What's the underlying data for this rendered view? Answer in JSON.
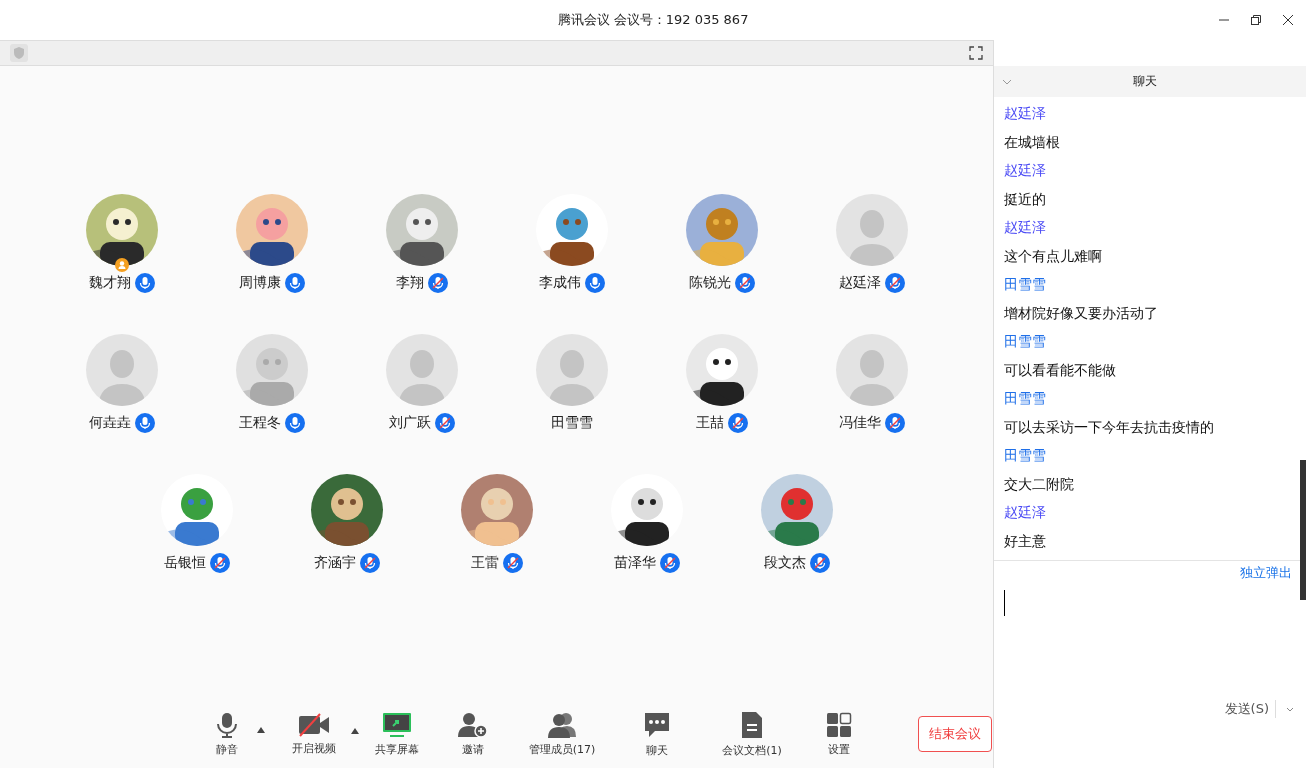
{
  "window": {
    "title": "腾讯会议 会议号：192 035 867"
  },
  "participant_rows": [
    {
      "participants": [
        {
          "name": "魏才翔",
          "photo": true,
          "host": true,
          "mic_shown": true,
          "muted": false
        },
        {
          "name": "周博康",
          "photo": true,
          "host": false,
          "mic_shown": true,
          "muted": false
        },
        {
          "name": "李翔",
          "photo": true,
          "host": false,
          "mic_shown": true,
          "muted": true
        },
        {
          "name": "李成伟",
          "photo": true,
          "host": false,
          "mic_shown": true,
          "muted": false
        },
        {
          "name": "陈锐光",
          "photo": true,
          "host": false,
          "mic_shown": true,
          "muted": true
        },
        {
          "name": "赵廷泽",
          "photo": false,
          "host": false,
          "mic_shown": true,
          "muted": true
        }
      ]
    },
    {
      "participants": [
        {
          "name": "何垚垚",
          "photo": false,
          "host": false,
          "mic_shown": true,
          "muted": false
        },
        {
          "name": "王程冬",
          "photo": true,
          "host": false,
          "mic_shown": true,
          "muted": false
        },
        {
          "name": "刘广跃",
          "photo": false,
          "host": false,
          "mic_shown": true,
          "muted": true
        },
        {
          "name": "田雪雪",
          "photo": false,
          "host": false,
          "mic_shown": false
        },
        {
          "name": "王喆",
          "photo": true,
          "host": false,
          "mic_shown": true,
          "muted": true
        },
        {
          "name": "冯佳华",
          "photo": false,
          "host": false,
          "mic_shown": true,
          "muted": true
        }
      ]
    },
    {
      "participants": [
        {
          "name": "岳银恒",
          "photo": true,
          "host": false,
          "mic_shown": true,
          "muted": true
        },
        {
          "name": "齐涵宇",
          "photo": true,
          "host": false,
          "mic_shown": true,
          "muted": true
        },
        {
          "name": "王雷",
          "photo": true,
          "host": false,
          "mic_shown": true,
          "muted": true
        },
        {
          "name": "苗泽华",
          "photo": true,
          "host": false,
          "mic_shown": true,
          "muted": true
        },
        {
          "name": "段文杰",
          "photo": true,
          "host": false,
          "mic_shown": true,
          "muted": true
        }
      ]
    }
  ],
  "toolbar": [
    {
      "kind": "mic",
      "label": "静音",
      "menu": true
    },
    {
      "kind": "video",
      "label": "开启视频",
      "menu": true
    },
    {
      "kind": "share",
      "label": "共享屏幕",
      "menu": false
    },
    {
      "kind": "invite",
      "label": "邀请",
      "menu": false
    },
    {
      "kind": "members",
      "label": "管理成员(17)",
      "menu": false
    },
    {
      "kind": "chat",
      "label": "聊天",
      "menu": false
    },
    {
      "kind": "docs",
      "label": "会议文档(1)",
      "menu": false
    },
    {
      "kind": "settings",
      "label": "设置",
      "menu": false
    }
  ],
  "end_button": "结束会议",
  "chat": {
    "title": "聊天",
    "messages": [
      {
        "sender": "赵廷泽",
        "color": "#4b4bf5",
        "text": "在城墙根"
      },
      {
        "sender": "赵廷泽",
        "color": "#4b4bf5",
        "text": "挺近的"
      },
      {
        "sender": "赵廷泽",
        "color": "#4b4bf5",
        "text": "这个有点儿难啊"
      },
      {
        "sender": "田雪雪",
        "color": "#1f6fe8",
        "text": "增材院好像又要办活动了"
      },
      {
        "sender": "田雪雪",
        "color": "#1f6fe8",
        "text": "可以看看能不能做"
      },
      {
        "sender": "田雪雪",
        "color": "#1f6fe8",
        "text": "可以去采访一下今年去抗击疫情的"
      },
      {
        "sender": "田雪雪",
        "color": "#1f6fe8",
        "text": "交大二附院"
      },
      {
        "sender": "赵廷泽",
        "color": "#4b4bf5",
        "text": "好主意"
      }
    ],
    "popout_link": "独立弹出",
    "send_button": "发送(S)"
  }
}
